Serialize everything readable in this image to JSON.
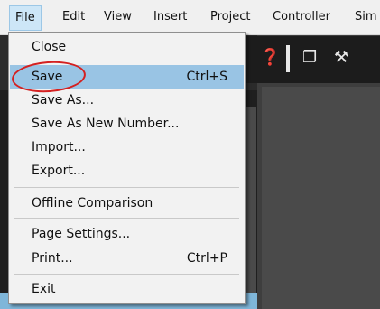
{
  "menubar": {
    "items": [
      {
        "label": "File",
        "active": true
      },
      {
        "label": "Edit"
      },
      {
        "label": "View"
      },
      {
        "label": "Insert"
      },
      {
        "label": "Project"
      },
      {
        "label": "Controller"
      },
      {
        "label": "Sim"
      }
    ]
  },
  "file_menu": {
    "items": [
      {
        "label": "Close",
        "shortcut": ""
      },
      {
        "label": "Save",
        "shortcut": "Ctrl+S",
        "highlighted": true,
        "circled": true
      },
      {
        "label": "Save As...",
        "shortcut": ""
      },
      {
        "label": "Save As New Number...",
        "shortcut": ""
      },
      {
        "label": "Import...",
        "shortcut": ""
      },
      {
        "label": "Export...",
        "shortcut": ""
      },
      {
        "label": "Offline Comparison",
        "shortcut": ""
      },
      {
        "label": "Page Settings...",
        "shortcut": ""
      },
      {
        "label": "Print...",
        "shortcut": "Ctrl+P"
      },
      {
        "label": "Exit",
        "shortcut": ""
      }
    ]
  },
  "colors": {
    "highlight": "#99c4e4",
    "circle": "#d42020",
    "menu_bg": "#f2f2f2",
    "workspace": "#3e3e3e"
  },
  "icons": [
    "help-icon",
    "window-icon",
    "hammer-icon"
  ]
}
